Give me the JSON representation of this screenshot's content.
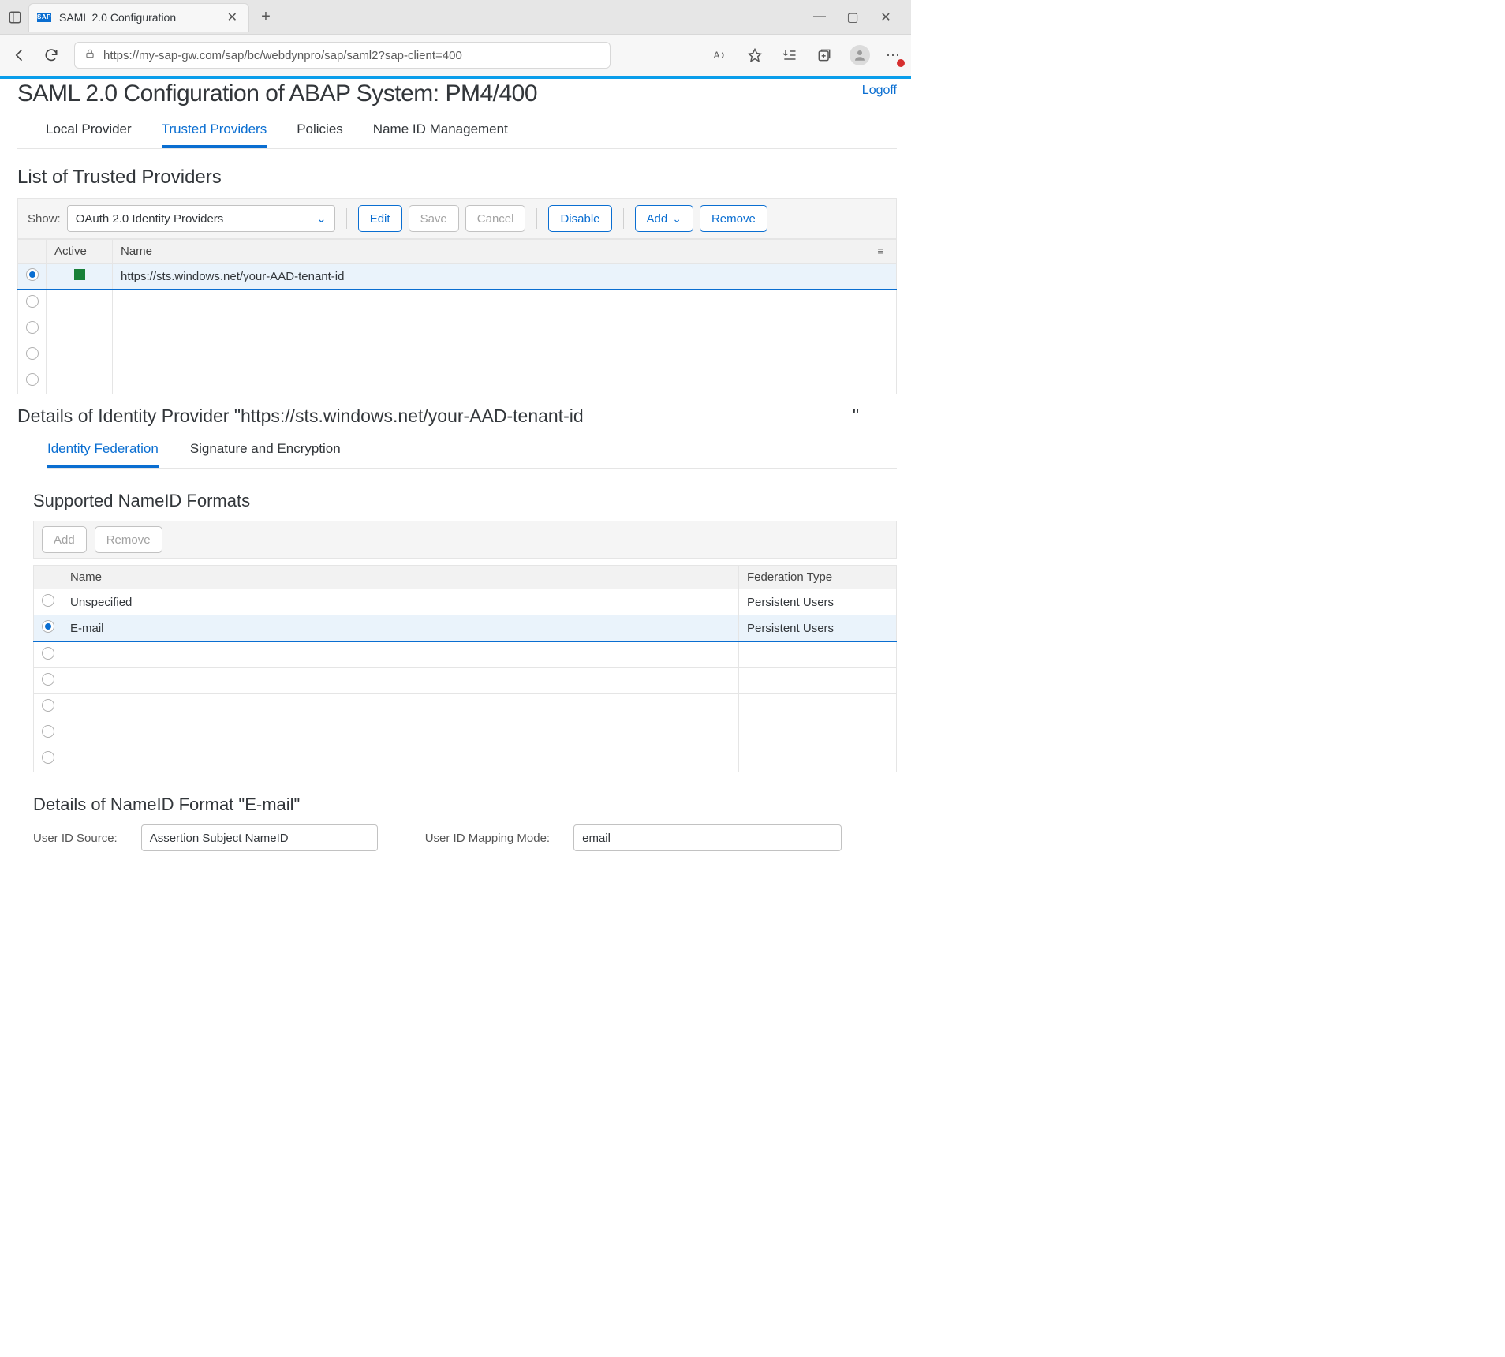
{
  "browser": {
    "tab_title": "SAML 2.0 Configuration",
    "url": "https://my-sap-gw.com/sap/bc/webdynpro/sap/saml2?sap-client=400"
  },
  "header": {
    "title": "SAML 2.0 Configuration of ABAP System: PM4/400",
    "logoff": "Logoff"
  },
  "tabs": {
    "local": "Local Provider",
    "trusted": "Trusted Providers",
    "policies": "Policies",
    "nameid_mgmt": "Name ID Management"
  },
  "trusted_section": {
    "title": "List of Trusted Providers",
    "show_label": "Show:",
    "show_value": "OAuth 2.0 Identity Providers",
    "buttons": {
      "edit": "Edit",
      "save": "Save",
      "cancel": "Cancel",
      "disable": "Disable",
      "add": "Add",
      "remove": "Remove"
    },
    "columns": {
      "active": "Active",
      "name": "Name"
    },
    "row": {
      "name_part1": "https://sts.windows.net/",
      "name_part2": "your-AAD-tenant-id"
    }
  },
  "details": {
    "title_prefix": "Details of Identity Provider \"",
    "url_part1": "https://sts.windows.net/",
    "url_part2": "your-AAD-tenant-id",
    "title_suffix": "\"",
    "sub_tabs": {
      "identity": "Identity Federation",
      "sig": "Signature and Encryption"
    }
  },
  "nameid_section": {
    "title": "Supported NameID Formats",
    "buttons": {
      "add": "Add",
      "remove": "Remove"
    },
    "columns": {
      "name": "Name",
      "federation": "Federation Type"
    },
    "rows": [
      {
        "name": "Unspecified",
        "federation": "Persistent Users",
        "selected": false
      },
      {
        "name": "E-mail",
        "federation": "Persistent Users",
        "selected": true
      }
    ]
  },
  "nameid_details": {
    "title": "Details of NameID Format \"E-mail\"",
    "source_label": "User ID Source:",
    "source_value": "Assertion Subject NameID",
    "mode_label": "User ID Mapping Mode:",
    "mode_value": "email"
  }
}
